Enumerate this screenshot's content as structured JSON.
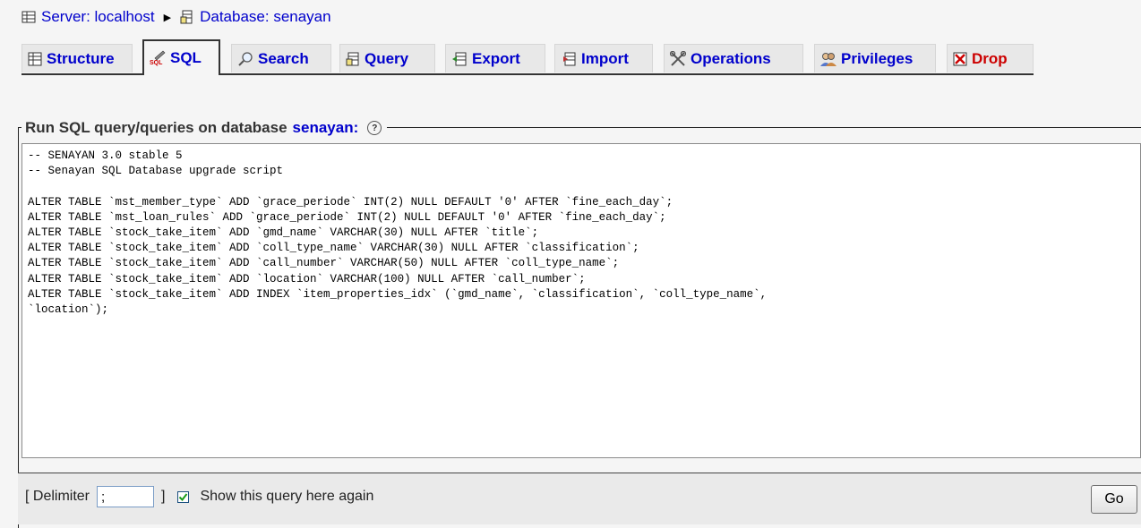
{
  "breadcrumb": {
    "server_label": "Server: localhost",
    "database_label": "Database: senayan"
  },
  "tabs": [
    {
      "label": "Structure",
      "icon": "structure-icon"
    },
    {
      "label": "SQL",
      "icon": "sql-icon",
      "active": true
    },
    {
      "label": "Search",
      "icon": "search-icon"
    },
    {
      "label": "Query",
      "icon": "query-icon"
    },
    {
      "label": "Export",
      "icon": "export-icon"
    },
    {
      "label": "Import",
      "icon": "import-icon"
    },
    {
      "label": "Operations",
      "icon": "operations-icon"
    },
    {
      "label": "Privileges",
      "icon": "privileges-icon"
    },
    {
      "label": "Drop",
      "icon": "drop-icon"
    }
  ],
  "legend": {
    "text": "Run SQL query/queries on database",
    "database": "senayan:"
  },
  "editor": {
    "lines": [
      "-- SENAYAN 3.0 stable 5",
      "-- Senayan SQL Database upgrade script",
      "",
      "ALTER TABLE `mst_member_type` ADD `grace_periode` INT(2) NULL DEFAULT '0' AFTER `fine_each_day`;",
      "ALTER TABLE `mst_loan_rules` ADD `grace_periode` INT(2) NULL DEFAULT '0' AFTER `fine_each_day`;",
      "ALTER TABLE `stock_take_item` ADD `gmd_name` VARCHAR(30) NULL AFTER `title`;",
      "ALTER TABLE `stock_take_item` ADD `coll_type_name` VARCHAR(30) NULL AFTER `classification`;",
      "ALTER TABLE `stock_take_item` ADD `call_number` VARCHAR(50) NULL AFTER `coll_type_name`;",
      "ALTER TABLE `stock_take_item` ADD `location` VARCHAR(100) NULL AFTER `call_number`;",
      "ALTER TABLE `stock_take_item` ADD INDEX `item_properties_idx` (`gmd_name`, `classification`, `coll_type_name`,",
      "`location`);"
    ]
  },
  "footer": {
    "delimiter_open": "[ Delimiter",
    "delimiter_value": ";",
    "delimiter_close": "]",
    "show_query_label": "Show this query here again",
    "show_query_checked": true,
    "go_label": "Go"
  }
}
